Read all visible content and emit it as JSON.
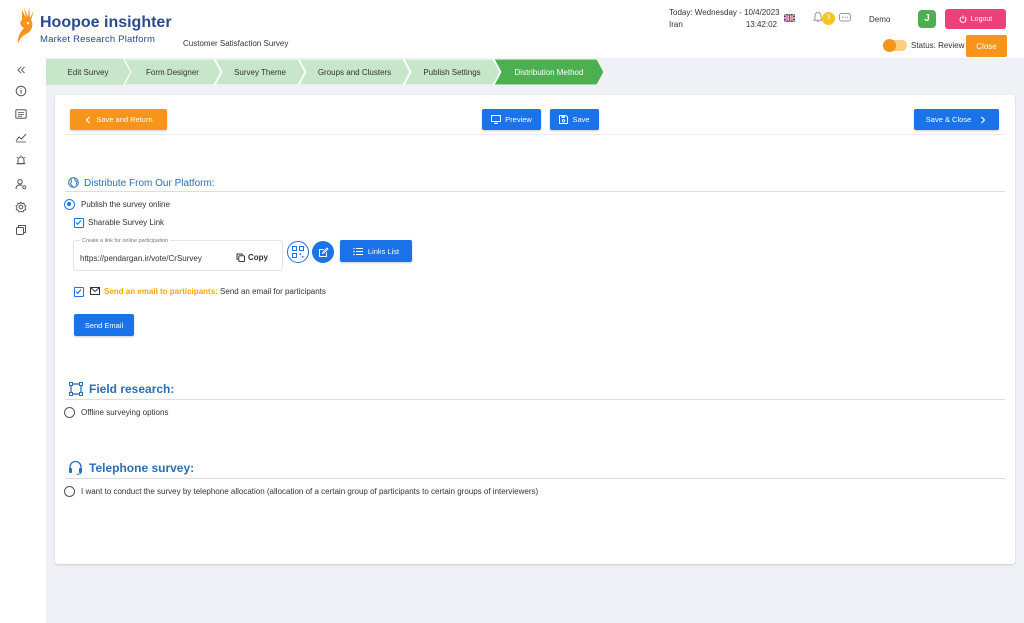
{
  "header": {
    "brand": "Hoopoe insighter",
    "brand_sub": "Market Research Platform",
    "survey_name": "Customer Satisfaction Survey",
    "date_line": "Today: Wednesday - 10/4/2023",
    "location": "Iran",
    "time": "13:42:02",
    "notification_count": "3",
    "user_name": "Demo",
    "avatar_letter": "J",
    "logout_label": "Logout",
    "status_label": "Status: Review",
    "close_label": "Close"
  },
  "steps": [
    {
      "label": "Edit Survey"
    },
    {
      "label": "Form Designer"
    },
    {
      "label": "Survey Theme"
    },
    {
      "label": "Groups and Clusters"
    },
    {
      "label": "Publish Settings"
    },
    {
      "label": "Distribution Method"
    }
  ],
  "toolbar": {
    "save_return_label": "Save and Return",
    "preview_label": "Preview",
    "save_label": "Save",
    "save_close_label": "Save & Close"
  },
  "platform": {
    "title": "Distribute From Our Platform:",
    "publish_online_label": "Publish the survey online",
    "sharable_link_label": "Sharable Survey Link",
    "link_caption": "Create a link for online participation",
    "link_url": "https://pendargan.ir/vote/CrSurvey",
    "copy_label": "Copy",
    "links_list_label": "Links List",
    "email_highlight": "Send an email to participants:",
    "email_text": "Send an email for participants",
    "send_email_label": "Send Email"
  },
  "field": {
    "title": "Field research:",
    "option_label": "Offline surveying options"
  },
  "telephone": {
    "title": "Telephone survey:",
    "option_label": "I want to conduct the survey by telephone allocation (allocation of a certain group of participants to certain groups of interviewers)"
  },
  "colors": {
    "brand": "#2a4b8d",
    "accent_orange": "#f7941d",
    "accent_blue": "#1a73e8",
    "step_bg": "#c8e6c9",
    "step_active": "#4caf50",
    "logout": "#ec407a"
  }
}
